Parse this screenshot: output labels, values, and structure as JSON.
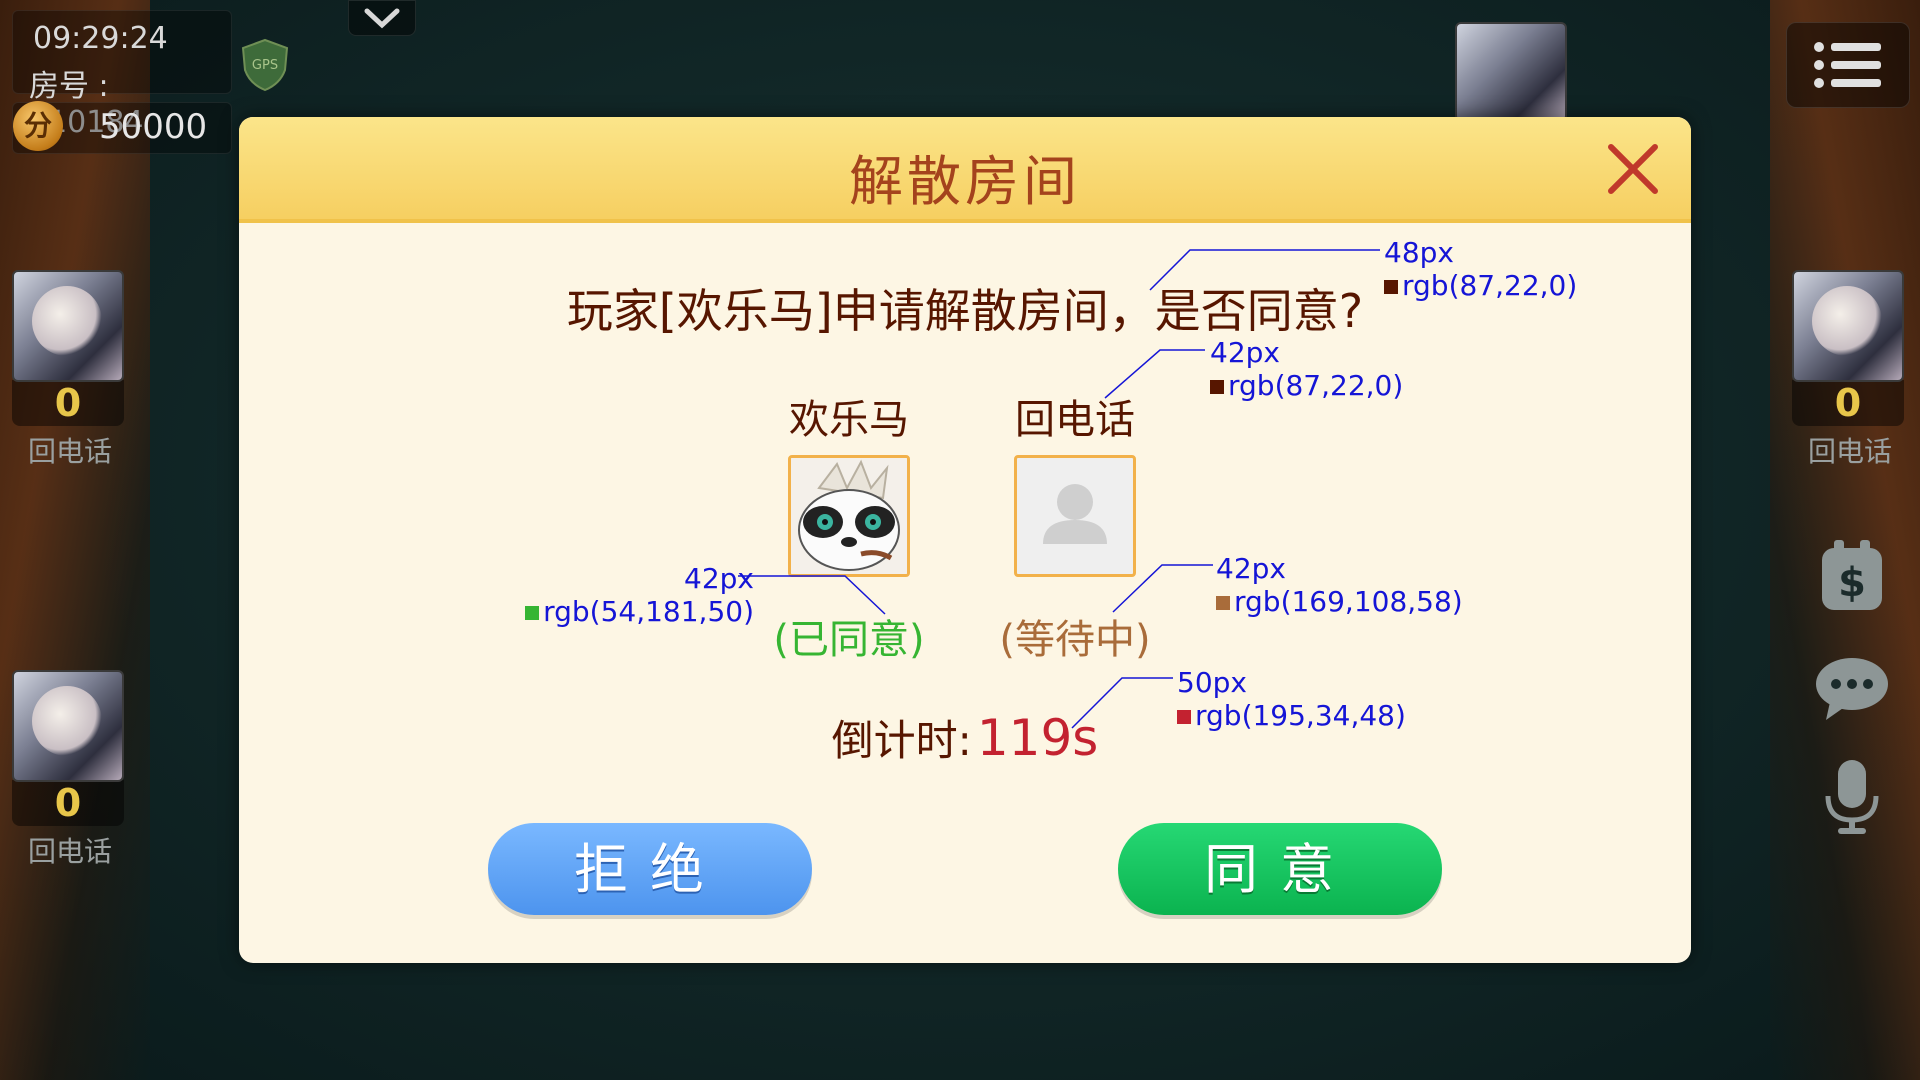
{
  "hud": {
    "time": "09:29:24",
    "room": "房号 : 810184",
    "gps_label": "GPS",
    "coin_glyph": "分",
    "coins": "50000"
  },
  "seats": [
    {
      "score": "0",
      "name": "回电话"
    },
    {
      "score": "0",
      "name": "回电话"
    },
    {
      "score": "0",
      "name": "回电话"
    }
  ],
  "dialog": {
    "title": "解散房间",
    "question": "玩家[欢乐马]申请解散房间，是否同意?",
    "players": [
      {
        "name": "欢乐马",
        "status": "(已同意)"
      },
      {
        "name": "回电话",
        "status": "(等待中)"
      }
    ],
    "countdown_label": "倒计时:",
    "countdown_value": "119s",
    "reject_label": "拒绝",
    "agree_label": "同意"
  },
  "annotations": [
    {
      "size": "48px",
      "color": "rgb(87,22,0)",
      "hex": "#571600"
    },
    {
      "size": "42px",
      "color": "rgb(87,22,0)",
      "hex": "#571600"
    },
    {
      "size": "42px",
      "color": "rgb(54,181,50)",
      "hex": "#36b532"
    },
    {
      "size": "42px",
      "color": "rgb(169,108,58)",
      "hex": "#a96c3a"
    },
    {
      "size": "50px",
      "color": "rgb(195,34,48)",
      "hex": "#c32230"
    }
  ],
  "icons": {
    "dropdown": "chevron-down-icon",
    "menu": "menu-list-icon",
    "close": "close-icon",
    "wallet": "dollar-bag-icon",
    "chat": "chat-bubble-icon",
    "mic": "microphone-icon",
    "default_avatar": "person-placeholder-icon"
  }
}
